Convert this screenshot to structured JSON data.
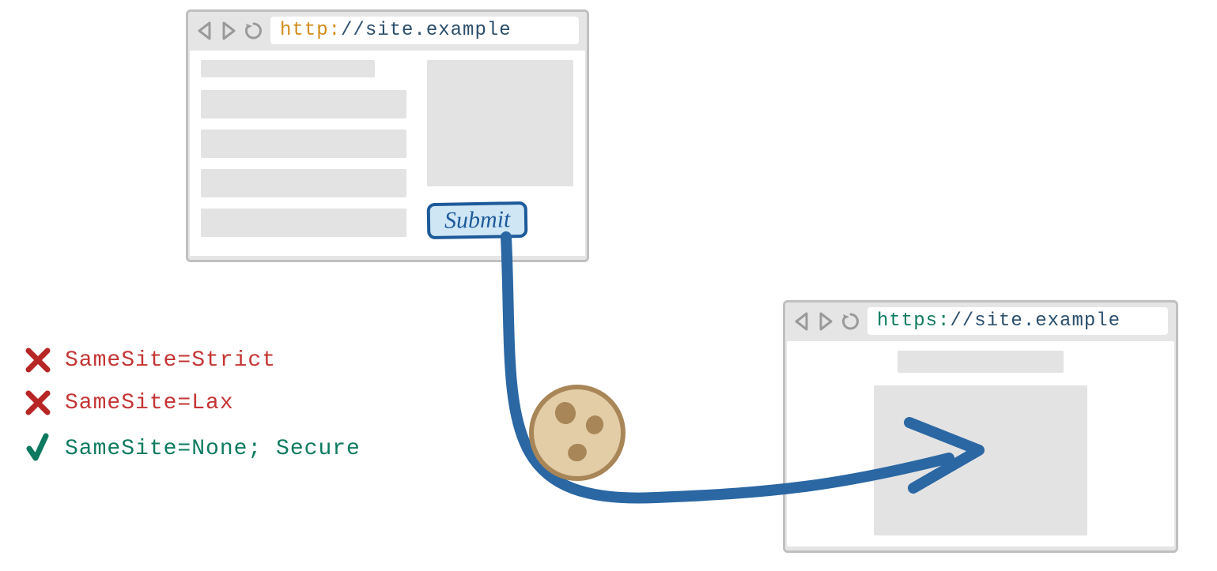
{
  "browser_top": {
    "url_scheme": "http:",
    "url_rest": "//site.example",
    "scheme_color": "#d38b1a",
    "submit_label": "Submit"
  },
  "browser_bottom": {
    "url_scheme": "https:",
    "url_rest": "//site.example",
    "scheme_color": "#0d7a5f"
  },
  "legend": {
    "rows": [
      {
        "mark": "cross",
        "text": "SameSite=Strict",
        "class": "legend-text-red"
      },
      {
        "mark": "cross",
        "text": "SameSite=Lax",
        "class": "legend-text-red"
      },
      {
        "mark": "check",
        "text": "SameSite=None; Secure",
        "class": "legend-text-green"
      }
    ]
  },
  "colors": {
    "arrow": "#2a67a3",
    "cross": "#b82525",
    "check": "#0d7a5f"
  }
}
